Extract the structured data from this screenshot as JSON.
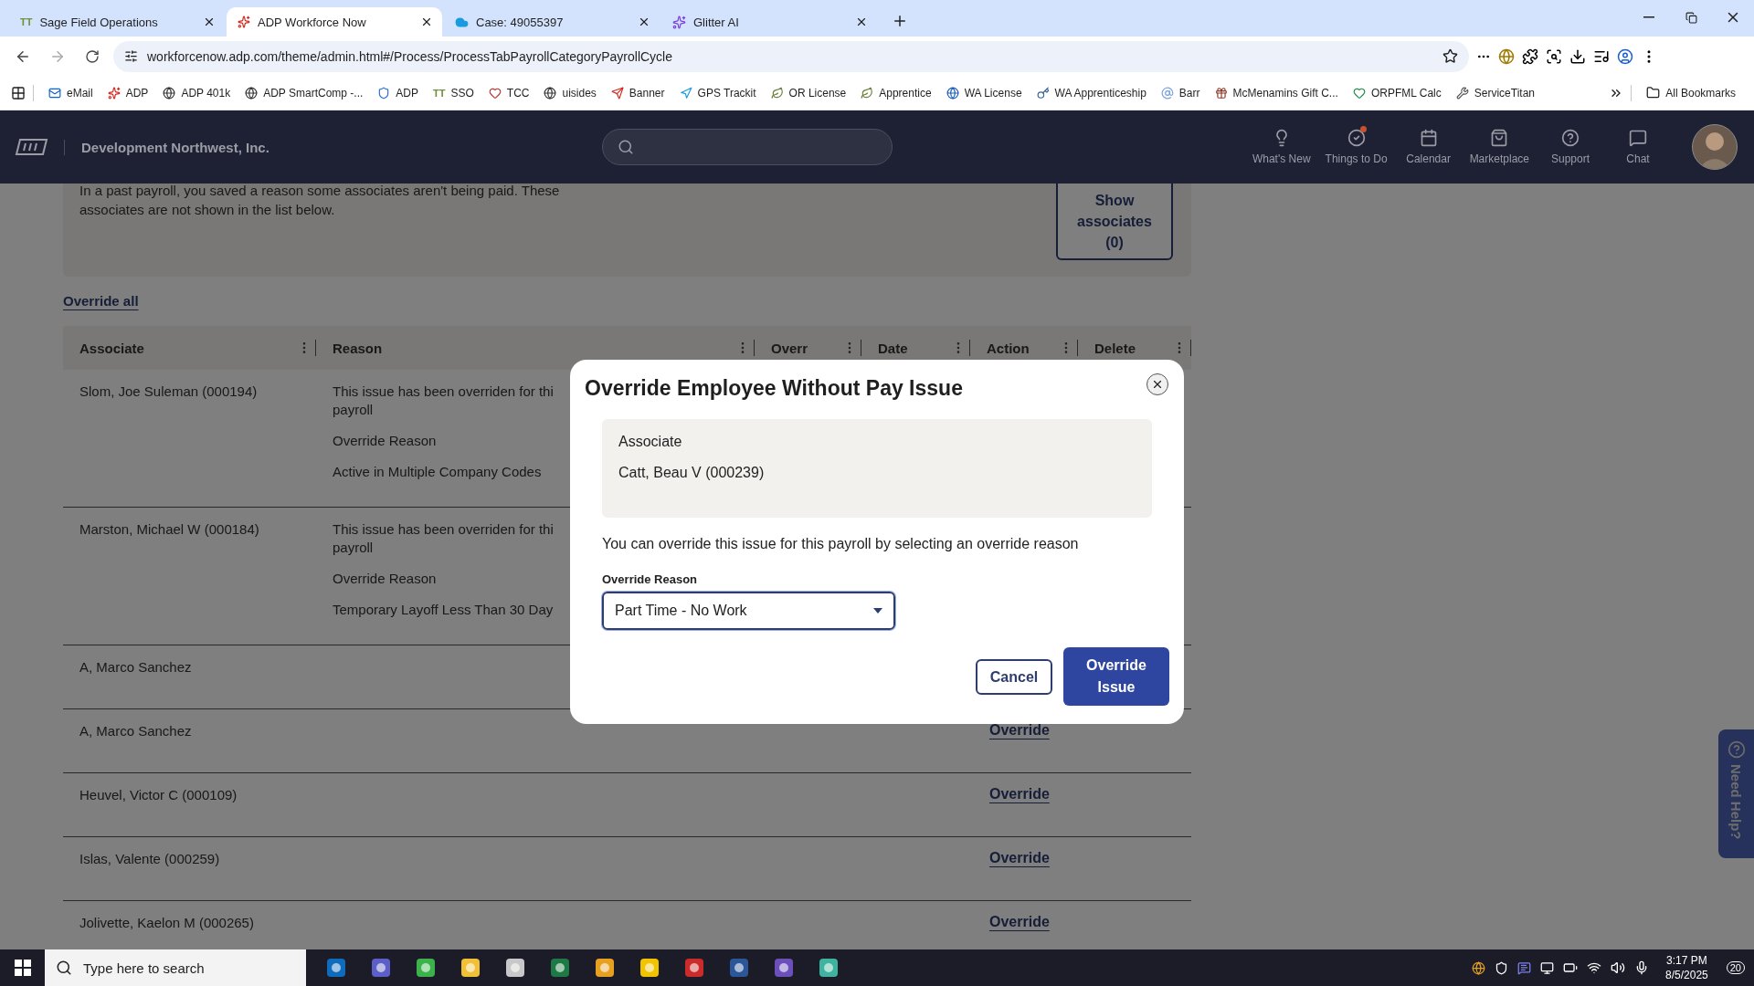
{
  "browser": {
    "tabs": [
      {
        "title": "Sage Field Operations",
        "icon_text": "TT",
        "selected": false
      },
      {
        "title": "ADP Workforce Now",
        "selected": true
      },
      {
        "title": "Case: 49055397",
        "selected": false
      },
      {
        "title": "Glitter AI",
        "selected": false
      }
    ],
    "url": "workforcenow.adp.com/theme/admin.html#/Process/ProcessTabPayrollCategoryPayrollCycle",
    "bookmarks": [
      {
        "label": "eMail"
      },
      {
        "label": "ADP"
      },
      {
        "label": "ADP 401k"
      },
      {
        "label": "ADP SmartComp -..."
      },
      {
        "label": "ADP"
      },
      {
        "label": "SSO",
        "icon_text": "TT"
      },
      {
        "label": "TCC"
      },
      {
        "label": "uisides"
      },
      {
        "label": "Banner"
      },
      {
        "label": "GPS Trackit"
      },
      {
        "label": "OR License"
      },
      {
        "label": "Apprentice"
      },
      {
        "label": "WA License"
      },
      {
        "label": "WA Apprenticeship"
      },
      {
        "label": "Barr"
      },
      {
        "label": "McMenamins Gift C..."
      },
      {
        "label": "ORPFML Calc"
      },
      {
        "label": "ServiceTitan"
      }
    ],
    "all_bookmarks": "All Bookmarks"
  },
  "header": {
    "company": "Development Northwest, Inc.",
    "nav": [
      {
        "label": "What's New",
        "has_dot": false
      },
      {
        "label": "Things to Do",
        "has_dot": true
      },
      {
        "label": "Calendar",
        "has_dot": false
      },
      {
        "label": "Marketplace",
        "has_dot": false
      },
      {
        "label": "Support",
        "has_dot": false
      },
      {
        "label": "Chat",
        "has_dot": false
      }
    ]
  },
  "banner": {
    "text": "In a past payroll, you saved a reason some associates aren't being paid. These associates are not shown in the list below.",
    "button": "Show associates (0)"
  },
  "override_all": "Override all",
  "table": {
    "columns": [
      "Associate",
      "Reason",
      "Overr",
      "Date",
      "Action",
      "Delete"
    ],
    "rows": [
      {
        "associate": "Slom, Joe Suleman (000194)",
        "reason": [
          "This issue has been overriden for thi",
          "payroll",
          "Override Reason",
          "Active in Multiple Company Codes"
        ]
      },
      {
        "associate": "Marston, Michael W (000184)",
        "reason": [
          "This issue has been overriden for thi",
          "payroll",
          "Override Reason",
          "Temporary Layoff Less Than 30 Day"
        ]
      },
      {
        "associate": "A, Marco Sanchez"
      },
      {
        "associate": "A, Marco Sanchez",
        "action": "Override"
      },
      {
        "associate": "Heuvel, Victor C (000109)",
        "action": "Override"
      },
      {
        "associate": "Islas, Valente (000259)",
        "action": "Override"
      },
      {
        "associate": "Jolivette, Kaelon M (000265)",
        "action": "Override"
      }
    ]
  },
  "modal": {
    "title": "Override Employee Without Pay Issue",
    "associate_label": "Associate",
    "associate_value": "Catt, Beau V (000239)",
    "message": "You can override this issue for this payroll by selecting an override reason",
    "field_label": "Override Reason",
    "field_value": "Part Time - No Work",
    "cancel": "Cancel",
    "confirm": "Override Issue"
  },
  "need_help": "Need Help?",
  "taskbar": {
    "search_placeholder": "Type here to search",
    "time": "3:17 PM",
    "date": "8/5/2025",
    "notifications": "20"
  }
}
